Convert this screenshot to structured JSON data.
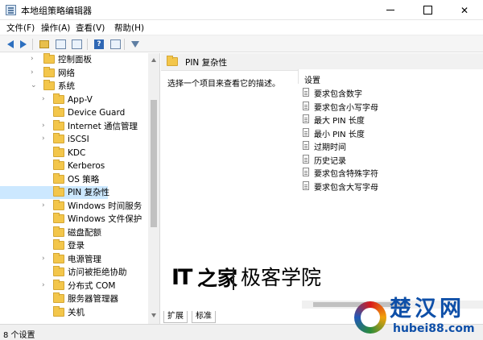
{
  "window": {
    "title": "本地组策略编辑器",
    "controls": {
      "minimize_icon": "minimize-icon",
      "maximize_icon": "maximize-icon",
      "close_glyph": "✕"
    }
  },
  "menubar": [
    "文件(F)",
    "操作(A)",
    "查看(V)",
    "帮助(H)"
  ],
  "toolbar": {
    "icons": [
      "back-arrow-icon",
      "forward-arrow-icon",
      "up-folder-icon",
      "show-hide-tree-icon",
      "export-list-icon",
      "help-icon",
      "properties-icon",
      "filter-icon"
    ]
  },
  "tree": {
    "items": [
      {
        "label": "控制面板",
        "expander": "›"
      },
      {
        "label": "网络",
        "expander": "›"
      },
      {
        "label": "系统",
        "expander": "⌄"
      },
      {
        "label": "App-V",
        "expander": "›"
      },
      {
        "label": "Device Guard",
        "expander": ""
      },
      {
        "label": "Internet 通信管理",
        "expander": "›"
      },
      {
        "label": "iSCSI",
        "expander": "›"
      },
      {
        "label": "KDC",
        "expander": ""
      },
      {
        "label": "Kerberos",
        "expander": ""
      },
      {
        "label": "OS 策略",
        "expander": ""
      },
      {
        "label": "PIN 复杂性",
        "expander": "",
        "selected": true
      },
      {
        "label": "Windows 时间服务",
        "expander": "›"
      },
      {
        "label": "Windows 文件保护",
        "expander": ""
      },
      {
        "label": "磁盘配额",
        "expander": ""
      },
      {
        "label": "登录",
        "expander": ""
      },
      {
        "label": "电源管理",
        "expander": "›"
      },
      {
        "label": "访问被拒绝协助",
        "expander": ""
      },
      {
        "label": "分布式 COM",
        "expander": "›"
      },
      {
        "label": "服务器管理器",
        "expander": ""
      },
      {
        "label": "关机",
        "expander": ""
      }
    ]
  },
  "right_pane": {
    "title": "PIN 复杂性",
    "description": "选择一个项目来查看它的描述。",
    "settings_label": "设置",
    "policies": [
      "要求包含数字",
      "要求包含小写字母",
      "最大 PIN 长度",
      "最小 PIN 长度",
      "过期时间",
      "历史记录",
      "要求包含特殊字符",
      "要求包含大写字母"
    ]
  },
  "tabs": [
    "扩展",
    "标准"
  ],
  "status": {
    "text": "8 个设置"
  },
  "watermark": {
    "it": "IT",
    "home": "之家",
    "chinese": "极客学院"
  },
  "brand_logo": {
    "main": "楚汉网",
    "url": "hubei88.com"
  },
  "colors": {
    "selected": "#cce8ff",
    "brand": "#0e4fa8"
  }
}
